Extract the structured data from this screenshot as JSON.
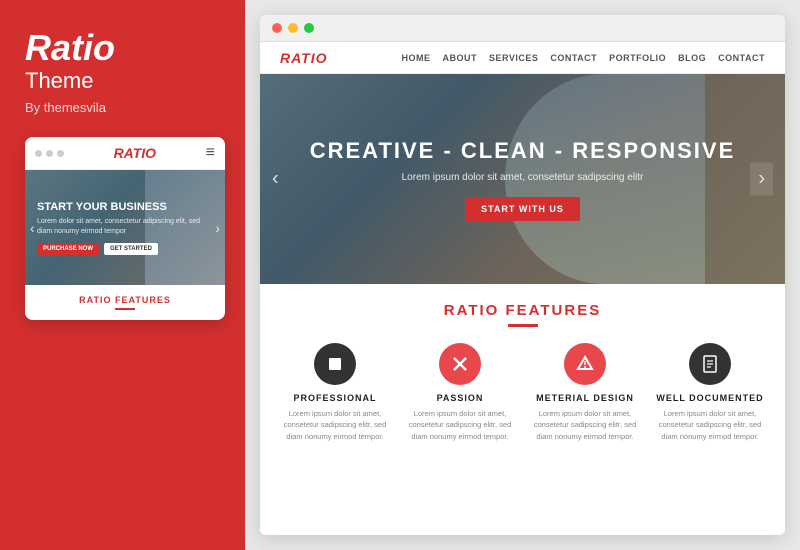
{
  "left": {
    "logo": {
      "title": "Ratio",
      "subtitle": "Theme",
      "by": "By themesvila"
    },
    "mobile": {
      "logo": "RATIO",
      "hamburger": "≡",
      "hero": {
        "title": "START YOUR BUSINESS",
        "text": "Lorem dolor sit amet, consectetur adipiscing elit, sed diam nonumy eirmod tempor",
        "btn_primary": "PURCHASE NOW",
        "btn_secondary": "GET STARTED"
      },
      "features": {
        "label_black": "RATIO",
        "label_red": "FEATURES"
      }
    }
  },
  "right": {
    "browser": {
      "nav": {
        "logo": "RATIO",
        "links": [
          "HOME",
          "ABOUT",
          "SERVICES",
          "CONTACT",
          "PORTFOLIO",
          "BLOG",
          "CONTACT"
        ]
      },
      "hero": {
        "title": "CREATIVE - CLEAN - RESPONSIVE",
        "subtitle": "Lorem ipsum dolor sit amet, consetetur sadipscing elitr",
        "btn": "START WITH US",
        "arrow_left": "‹",
        "arrow_right": "›"
      },
      "features": {
        "label_black": "RATIO",
        "label_red": "FEATURES",
        "items": [
          {
            "icon": "▪",
            "icon_type": "professional",
            "title": "PROFESSIONAL",
            "text": "Lorem ipsum dolor sit amet, consetetur sadipscing elitr, sed diam nonumy eirmod tempor."
          },
          {
            "icon": "✕",
            "icon_type": "passion",
            "title": "PASSION",
            "text": "Lorem ipsum dolor sit amet, consetetur sadipscing elitr, sed diam nonumy eirmod tempor."
          },
          {
            "icon": "◈",
            "icon_type": "material",
            "title": "METERIAL DESIGN",
            "text": "Lorem ipsum dolor sit amet, consetetur sadipscing elitr, sed diam nonumy eirmod tempor."
          },
          {
            "icon": "📄",
            "icon_type": "documented",
            "title": "WELL DOCUMENTED",
            "text": "Lorem ipsum dolor sit amet, consetetur sadipscing elitr, sed diam nonumy eirmod tempor."
          }
        ]
      }
    }
  }
}
